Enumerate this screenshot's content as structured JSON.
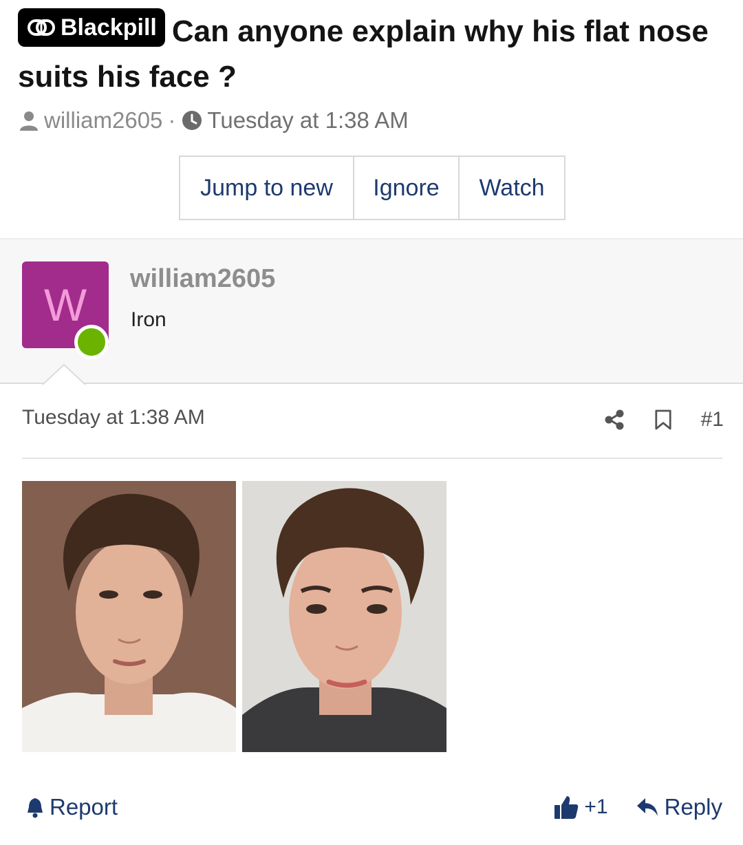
{
  "thread": {
    "prefix": "Blackpill",
    "title": "Can anyone explain why his flat nose suits his face ?",
    "author": "william2605",
    "separator": "·",
    "date": "Tuesday at 1:38 AM"
  },
  "thread_actions": {
    "jump_label": "Jump to new",
    "ignore_label": "Ignore",
    "watch_label": "Watch"
  },
  "post": {
    "avatar_letter": "W",
    "username": "william2605",
    "user_title": "Iron",
    "date": "Tuesday at 1:38 AM",
    "post_number": "#1",
    "images": [
      {
        "name": "post-photo-1",
        "icon": "photo"
      },
      {
        "name": "post-photo-2",
        "icon": "photo"
      }
    ],
    "report_label": "Report",
    "like_count": "+1",
    "reply_label": "Reply"
  },
  "colors": {
    "link": "#1d3a6e",
    "avatar_bg": "#a12c8c",
    "avatar_letter": "#f29bd8",
    "online": "#6cb300",
    "prefix_bg": "#000000",
    "meta_text": "#8a8a8a"
  }
}
